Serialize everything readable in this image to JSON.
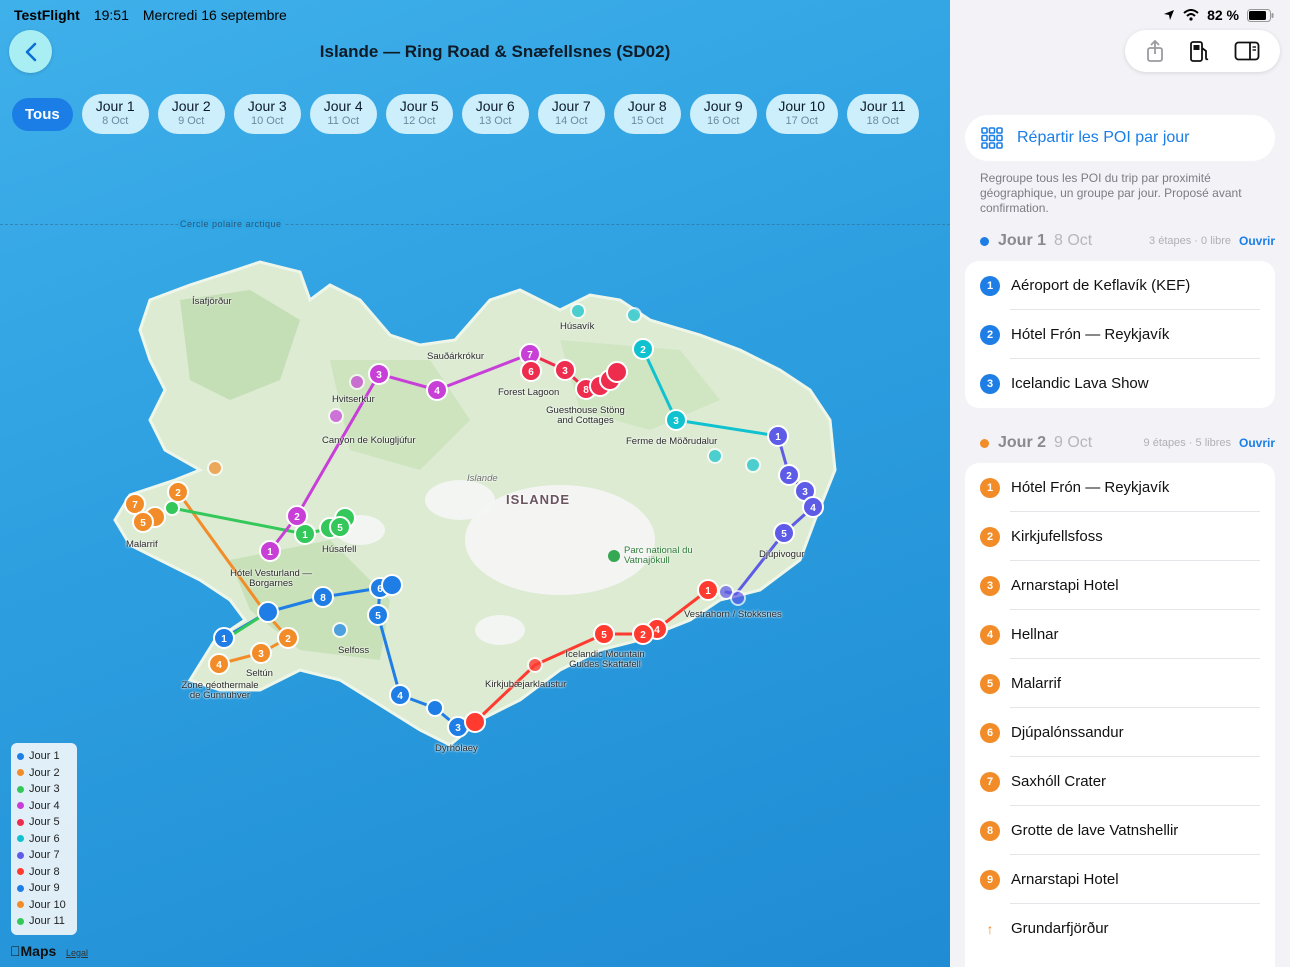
{
  "status": {
    "app": "TestFlight",
    "time": "19:51",
    "date": "Mercredi 16 septembre",
    "battery": "82 %"
  },
  "map": {
    "title": "Islande — Ring Road & Snæfellsnes (SD02)",
    "tab_all": "Tous",
    "days": [
      {
        "label": "Jour 1",
        "date": "8 Oct"
      },
      {
        "label": "Jour 2",
        "date": "9 Oct"
      },
      {
        "label": "Jour 3",
        "date": "10 Oct"
      },
      {
        "label": "Jour 4",
        "date": "11 Oct"
      },
      {
        "label": "Jour 5",
        "date": "12 Oct"
      },
      {
        "label": "Jour 6",
        "date": "13 Oct"
      },
      {
        "label": "Jour 7",
        "date": "14 Oct"
      },
      {
        "label": "Jour 8",
        "date": "15 Oct"
      },
      {
        "label": "Jour 9",
        "date": "16 Oct"
      },
      {
        "label": "Jour 10",
        "date": "17 Oct"
      },
      {
        "label": "Jour 11",
        "date": "18 Oct"
      }
    ],
    "polar_circle": "Cercle polaire arctique",
    "places": {
      "isafjordur": "Ísafjörður",
      "husavik": "Húsavík",
      "saudarkrokur": "Sauðárkrókur",
      "hvitserkur": "Hvitserkur",
      "forest_lagoon": "Forest Lagoon",
      "guesthouse": "Guesthouse Stöng and Cottages",
      "canyon": "Canyon de Kolugljúfur",
      "modrudalur": "Ferme de Möðrudalur",
      "islande_it": "Islande",
      "islande": "ISLANDE",
      "malarrif": "Malarrif",
      "husafell": "Húsafell",
      "vatnajokull": "Parc national du Vatnajökull",
      "djupivogur": "Djúpivogur",
      "vesturland": "Hótel Vesturland — Borgarnes",
      "vestrahorn": "Vestrahorn / Stokksnes",
      "selfoss": "Selfoss",
      "mountain_guides": "Icelandic Mountain Guides Skaftafell",
      "seltun": "Seltún",
      "gunnuhver": "Zone géothermale de Gunnuhver",
      "kirkjubaejar": "Kirkjubæjarklaustur",
      "dyrholaey": "Dyrhólaey"
    },
    "legend": [
      {
        "label": "Jour 1",
        "color": "#1e7ee6"
      },
      {
        "label": "Jour 2",
        "color": "#f28c28"
      },
      {
        "label": "Jour 3",
        "color": "#34c759"
      },
      {
        "label": "Jour 4",
        "color": "#c83fd8"
      },
      {
        "label": "Jour 5",
        "color": "#ee2d4e"
      },
      {
        "label": "Jour 6",
        "color": "#10c2cf"
      },
      {
        "label": "Jour 7",
        "color": "#5e5ce6"
      },
      {
        "label": "Jour 8",
        "color": "#ff3b30"
      },
      {
        "label": "Jour 9",
        "color": "#1e7ee6"
      },
      {
        "label": "Jour 10",
        "color": "#f28c28"
      },
      {
        "label": "Jour 11",
        "color": "#34c759"
      }
    ],
    "maps_logo": "Maps",
    "legal": "Legal"
  },
  "sidebar": {
    "distribute_label": "Répartir les POI par jour",
    "distribute_desc": "Regroupe tous les POI du trip par proximité géographique, un groupe par jour. Proposé avant confirmation.",
    "day1": {
      "name": "Jour 1",
      "date": "8 Oct",
      "meta": "3 étapes · 0 libre",
      "open": "Ouvrir",
      "color": "#1e7ee6",
      "items": [
        "Aéroport de Keflavík (KEF)",
        "Hótel Frón — Reykjavík",
        "Icelandic Lava Show"
      ]
    },
    "day2": {
      "name": "Jour 2",
      "date": "9 Oct",
      "meta": "9 étapes · 5 libres",
      "open": "Ouvrir",
      "color": "#f28c28",
      "items": [
        "Hótel Frón — Reykjavík",
        "Kirkjufellsfoss",
        "Arnarstapi Hotel",
        "Hellnar",
        "Malarrif",
        "Djúpalónssandur",
        "Saxhóll Crater",
        "Grotte de lave Vatnshellir",
        "Arnarstapi Hotel"
      ],
      "extra": "Grundarfjörður"
    }
  }
}
